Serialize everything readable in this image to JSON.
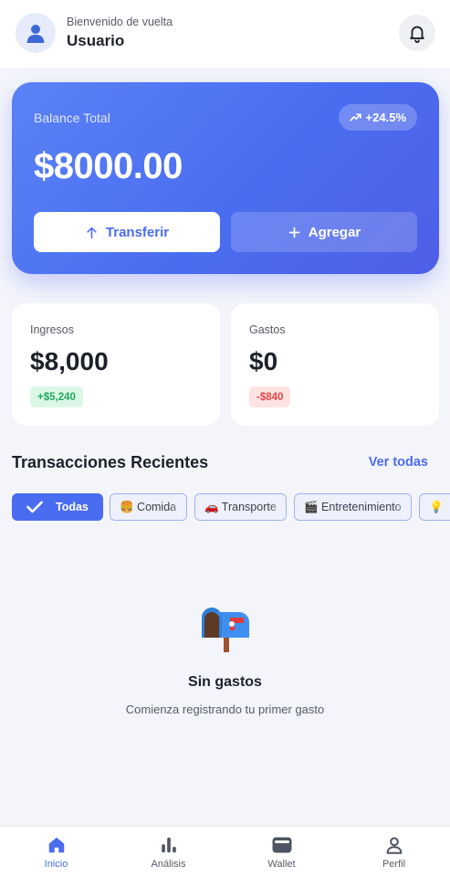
{
  "header": {
    "greeting": "Bienvenido de vuelta",
    "username": "Usuario",
    "avatar_icon": "user-icon",
    "notification_icon": "bell-icon"
  },
  "balance": {
    "label": "Balance Total",
    "amount": "$8000.00",
    "trend": "+24.5%",
    "trend_icon": "trending-up-icon",
    "transfer_label": "Transferir",
    "add_label": "Agregar"
  },
  "stats": {
    "income": {
      "label": "Ingresos",
      "value": "$8,000",
      "change": "+$5,240"
    },
    "expense": {
      "label": "Gastos",
      "value": "$0",
      "change": "-$840"
    }
  },
  "transactions": {
    "title": "Transacciones Recientes",
    "see_all": "Ver todas",
    "filters": [
      {
        "label": "Todas",
        "icon": "check-icon",
        "active": true
      },
      {
        "label": "🍔 Comida",
        "active": false
      },
      {
        "label": "🚗 Transporte",
        "active": false
      },
      {
        "label": "🎬 Entretenimiento",
        "active": false
      },
      {
        "label": "💡",
        "active": false
      }
    ],
    "empty": {
      "icon": "mailbox-icon",
      "title": "Sin gastos",
      "subtitle": "Comienza registrando tu primer gasto"
    }
  },
  "nav": [
    {
      "label": "Inicio",
      "icon": "home-icon",
      "active": true
    },
    {
      "label": "Análisis",
      "icon": "bar-chart-icon",
      "active": false
    },
    {
      "label": "Wallet",
      "icon": "wallet-icon",
      "active": false
    },
    {
      "label": "Perfil",
      "icon": "profile-icon",
      "active": false
    }
  ],
  "colors": {
    "accent": "#4a6cf0",
    "positive": "#22a85a",
    "negative": "#e24646",
    "background": "#f4f5fb"
  }
}
